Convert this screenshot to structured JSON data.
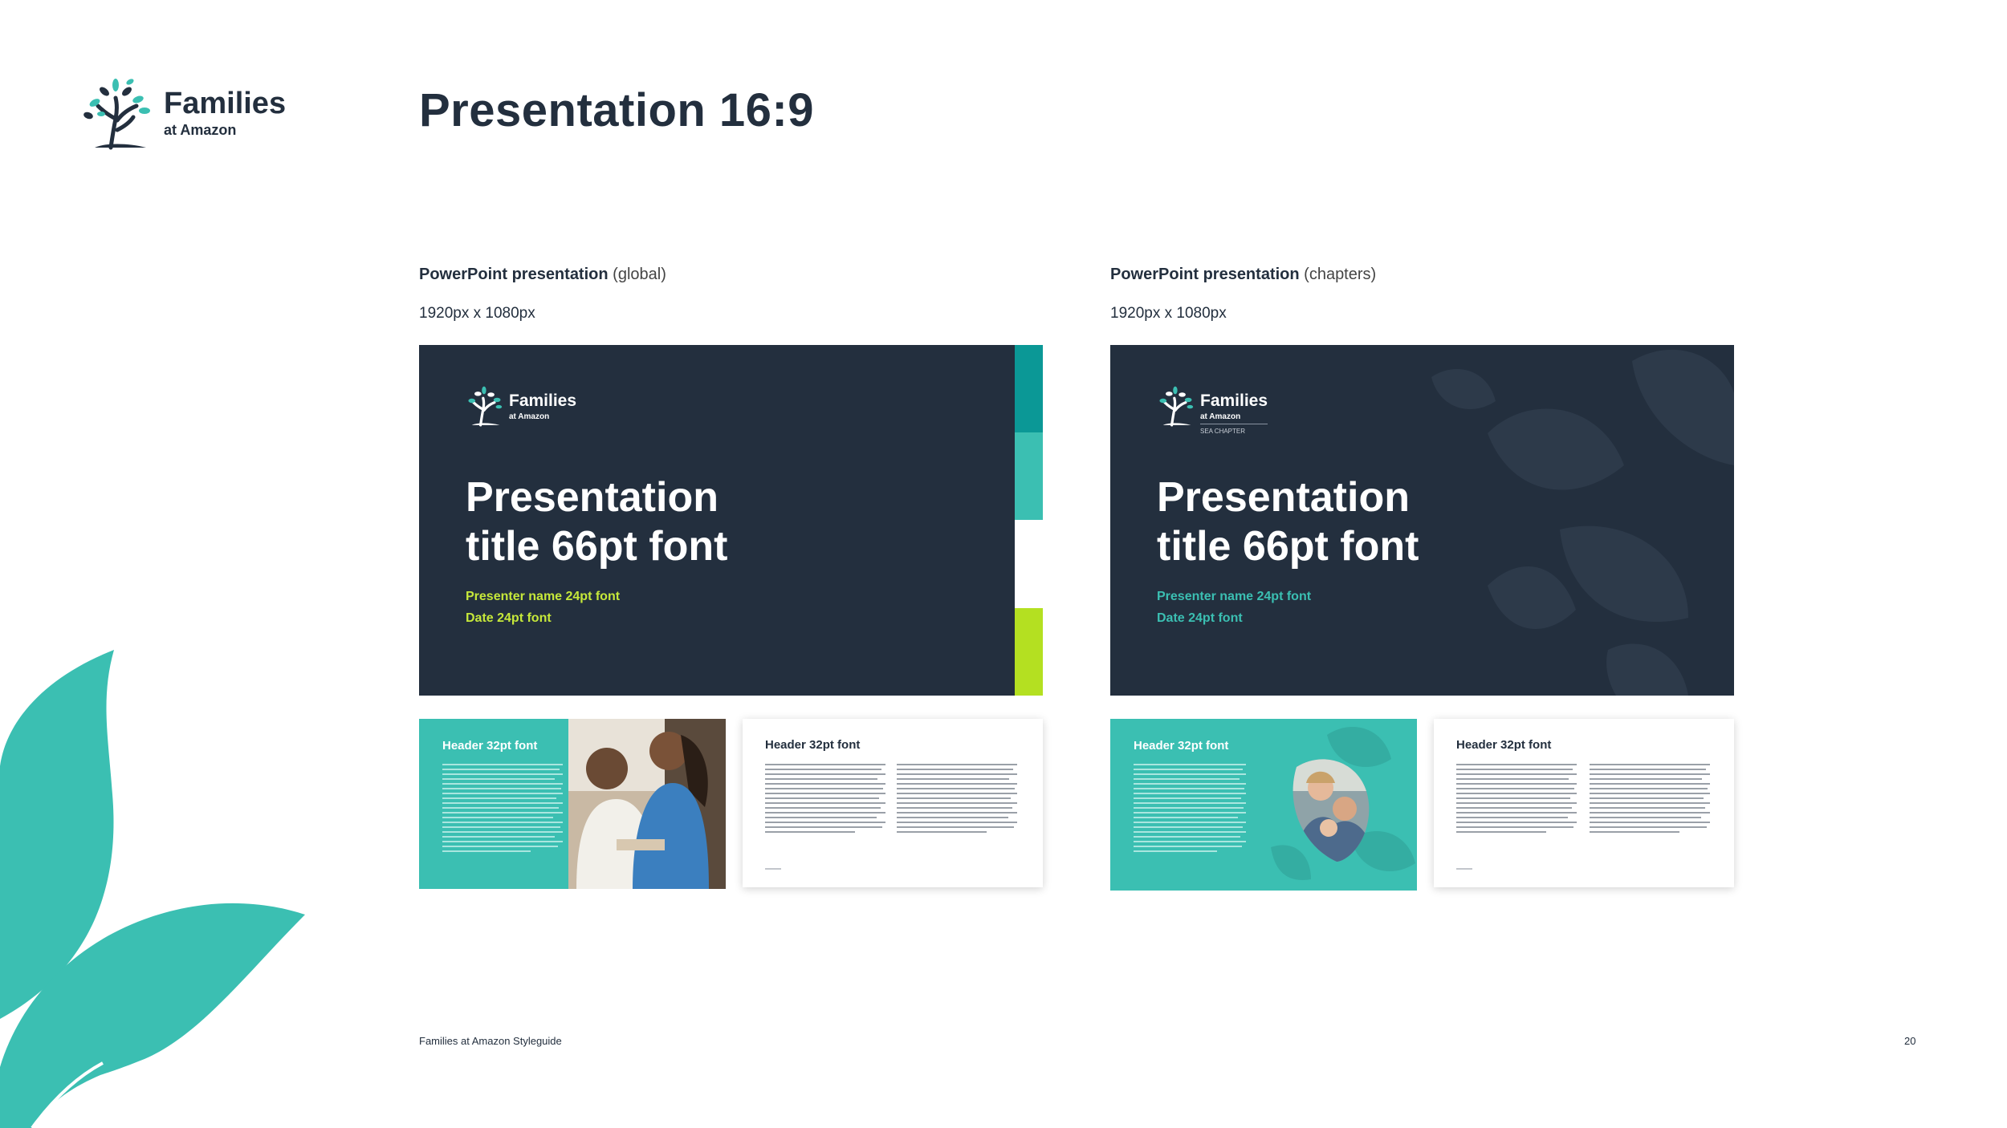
{
  "brand": {
    "name": "Families",
    "sub": "at Amazon",
    "color_navy": "#232f3e",
    "color_teal": "#3bbfb2",
    "color_dark_teal": "#0b9896",
    "color_lime": "#b4e021"
  },
  "page_title": "Presentation 16:9",
  "sections": [
    {
      "label_bold": "PowerPoint presentation",
      "label_light": "(global)",
      "dims": "1920px x 1080px",
      "slide": {
        "logo_name": "Families",
        "logo_sub": "at Amazon",
        "title_line1": "Presentation",
        "title_line2": "title 66pt font",
        "presenter": "Presenter name 24pt font",
        "date": "Date 24pt font",
        "accent_color": "#c6e83a"
      },
      "thumb_teal_header": "Header 32pt font",
      "thumb_white_header": "Header 32pt font"
    },
    {
      "label_bold": "PowerPoint presentation",
      "label_light": "(chapters)",
      "dims": "1920px x 1080px",
      "slide": {
        "logo_name": "Families",
        "logo_sub": "at Amazon",
        "chapter": "SEA CHAPTER",
        "title_line1": "Presentation",
        "title_line2": "title 66pt font",
        "presenter": "Presenter name 24pt font",
        "date": "Date 24pt font",
        "accent_color": "#3bbfb2"
      },
      "thumb_teal_header": "Header 32pt font",
      "thumb_white_header": "Header 32pt font"
    }
  ],
  "footer": {
    "left": "Families at Amazon Styleguide",
    "page": "20"
  }
}
